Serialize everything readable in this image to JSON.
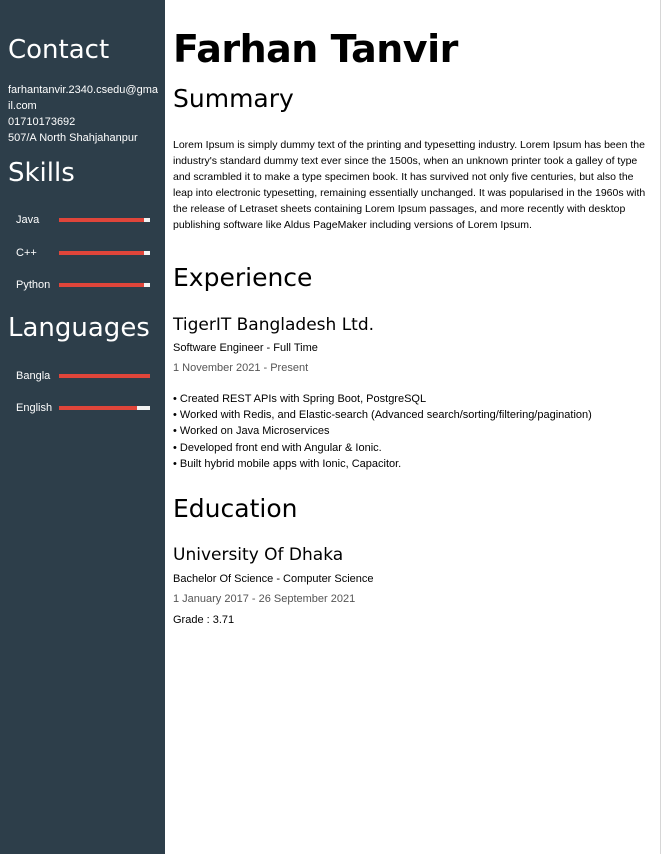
{
  "contact": {
    "title": "Contact",
    "lines": [
      "farhantanvir.2340.csedu@gmail.com",
      "01710173692",
      "507/A North Shahjahanpur"
    ]
  },
  "skills": {
    "title": "Skills",
    "items": [
      {
        "label": "Java",
        "level": 0.93
      },
      {
        "label": "C++",
        "level": 0.93
      },
      {
        "label": "Python",
        "level": 0.93
      }
    ]
  },
  "languages": {
    "title": "Languages",
    "items": [
      {
        "label": "Bangla",
        "level": 1.0
      },
      {
        "label": "English",
        "level": 0.86
      }
    ]
  },
  "colors": {
    "sidebar": "#2d3e4a",
    "bar_fill": "#e0453a",
    "bar_track": "#f2f2f2"
  },
  "main": {
    "name": "Farhan Tanvir",
    "summary": {
      "title": "Summary",
      "text": "Lorem Ipsum is simply dummy text of the printing and typesetting industry. Lorem Ipsum has been the industry's standard dummy text ever since the 1500s, when an unknown printer took a galley of type and scrambled it to make a type specimen book. It has survived not only five centuries, but also the leap into electronic typesetting, remaining essentially unchanged. It was popularised in the 1960s with the release of Letraset sheets containing Lorem Ipsum passages, and more recently with desktop publishing software like Aldus PageMaker including versions of Lorem Ipsum."
    },
    "experience": {
      "title": "Experience",
      "company": "TigerIT Bangladesh Ltd.",
      "role": "Software Engineer - Full Time",
      "dates": "1 November 2021 - Present",
      "bullets": [
        "• Created REST APIs with Spring Boot, PostgreSQL",
        "• Worked with Redis, and Elastic-search (Advanced search/sorting/filtering/pagination)",
        "• Worked on Java Microservices",
        "• Developed front end with Angular & Ionic.",
        "• Built hybrid mobile apps with Ionic, Capacitor."
      ]
    },
    "education": {
      "title": "Education",
      "school": "University Of Dhaka",
      "degree": "Bachelor Of Science - Computer Science",
      "dates": "1 January 2017 - 26 September 2021",
      "grade": "Grade : 3.71"
    }
  }
}
